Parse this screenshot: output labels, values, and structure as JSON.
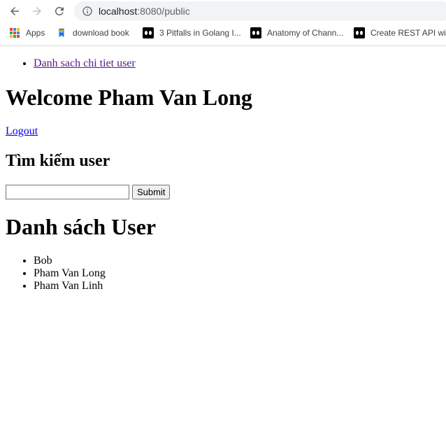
{
  "browser": {
    "url_host": "localhost",
    "url_rest": ":8080/public",
    "bookmarks": [
      {
        "label": "Apps",
        "icon": "apps-grid-icon"
      },
      {
        "label": "download book",
        "icon": "book-icon"
      },
      {
        "label": "3 Pitfalls in Golang I...",
        "icon": "medium-icon"
      },
      {
        "label": "Anatomy of Chann...",
        "icon": "medium-icon"
      },
      {
        "label": "Create REST API wit...",
        "icon": "medium-icon"
      }
    ]
  },
  "page": {
    "nav_link": "Danh sach chi tiet user",
    "welcome": "Welcome Pham Van Long",
    "logout": "Logout",
    "search_heading": "Tìm kiếm user",
    "search_value": "",
    "submit_label": "Submit",
    "list_heading": "Danh sách User",
    "users": [
      "Bob",
      "Pham Van Long",
      "Pham Van Linh"
    ]
  },
  "colors": {
    "link": "#0000ee",
    "visited_link": "#551a8b",
    "omnibox_bg": "#f1f3f4"
  }
}
